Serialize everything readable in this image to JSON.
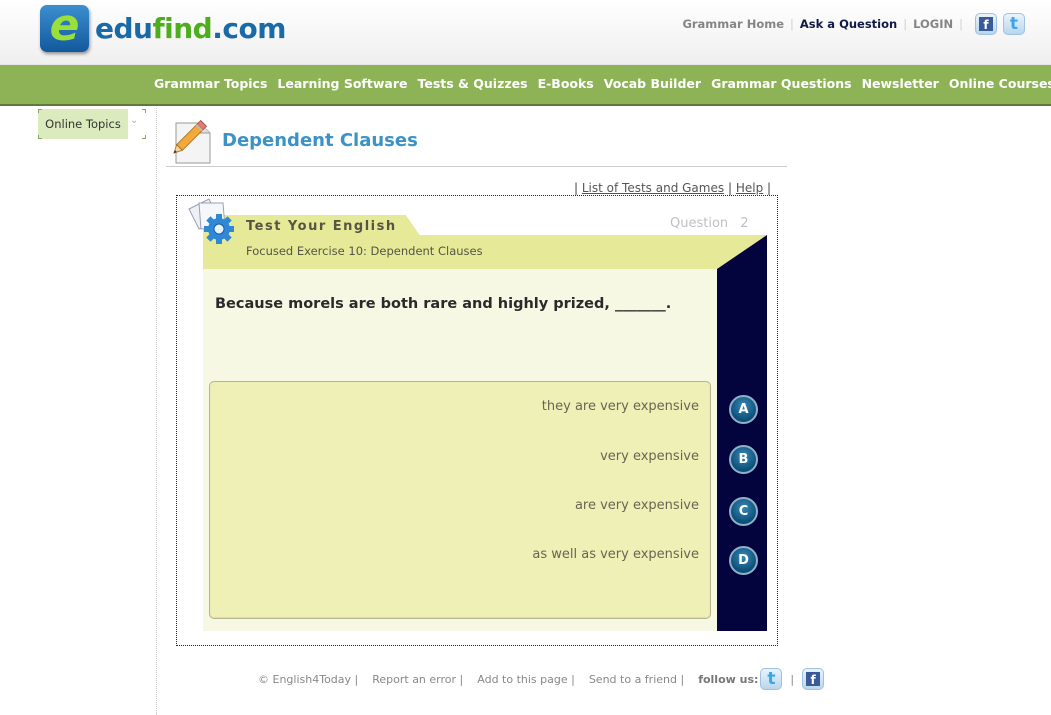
{
  "header": {
    "logo": {
      "part1": "edu",
      "part2": "find",
      "part3": ".com",
      "icon_letter": "e"
    },
    "top_links": [
      {
        "label": "Grammar Home"
      },
      {
        "label": "Ask a Question"
      },
      {
        "label": "LOGIN"
      }
    ],
    "social": {
      "facebook_glyph": "f",
      "twitter_glyph": "t"
    }
  },
  "nav": {
    "items": [
      "Grammar Topics",
      "Learning Software",
      "Tests & Quizzes",
      "E-Books",
      "Vocab Builder",
      "Grammar Questions",
      "Newsletter",
      "Online Courses"
    ]
  },
  "sidebar": {
    "topics_dropdown": {
      "label": "Online Topics",
      "chevron": "⌄"
    }
  },
  "page": {
    "title": "Dependent Clauses",
    "sublinks": {
      "sep": "|",
      "list_label": "List of Tests and Games",
      "help_label": "Help"
    }
  },
  "test": {
    "header_title": "Test Your English",
    "subtitle": "Focused Exercise 10: Dependent Clauses",
    "question_label": "Question",
    "question_number": "2",
    "question_text": "Because morels are both rare and highly prized,  _______.",
    "answers": [
      {
        "letter": "A",
        "text": "they are very expensive"
      },
      {
        "letter": "B",
        "text": "very expensive"
      },
      {
        "letter": "C",
        "text": "are very expensive"
      },
      {
        "letter": "D",
        "text": "as well as very expensive"
      }
    ]
  },
  "footer": {
    "copyright": "© English4Today |",
    "report": "Report an error |",
    "add": "Add to this page |",
    "send": "Send to a friend |",
    "follow_label": "follow us:",
    "pipe": "|"
  },
  "colors": {
    "nav_green": "#8db356",
    "title_blue": "#3a92c8",
    "panel_yellow": "#e6ea98",
    "dark_navy": "#03033d"
  }
}
